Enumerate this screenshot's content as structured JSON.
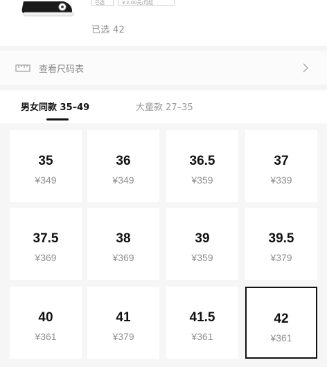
{
  "product": {
    "tags": [
      "已选",
      "￥2.00元/月起"
    ],
    "selected_text": "已选 42"
  },
  "size_chart": {
    "label": "查看尺码表"
  },
  "tabs": [
    {
      "label": "男女同款 35–49",
      "active": true
    },
    {
      "label": "大童款 27–35",
      "active": false
    }
  ],
  "sizes": [
    {
      "size": "35",
      "price": "¥349"
    },
    {
      "size": "36",
      "price": "¥349"
    },
    {
      "size": "36.5",
      "price": "¥359"
    },
    {
      "size": "37",
      "price": "¥339"
    },
    {
      "size": "37.5",
      "price": "¥369"
    },
    {
      "size": "38",
      "price": "¥369"
    },
    {
      "size": "39",
      "price": "¥359"
    },
    {
      "size": "39.5",
      "price": "¥379"
    },
    {
      "size": "40",
      "price": "¥361"
    },
    {
      "size": "41",
      "price": "¥379"
    },
    {
      "size": "41.5",
      "price": "¥361"
    },
    {
      "size": "42",
      "price": "¥361"
    }
  ],
  "selected_size": "42",
  "icons": {
    "ruler": "ruler-icon",
    "chevron": "chevron-right-icon",
    "shoe": "shoe-thumbnail"
  }
}
